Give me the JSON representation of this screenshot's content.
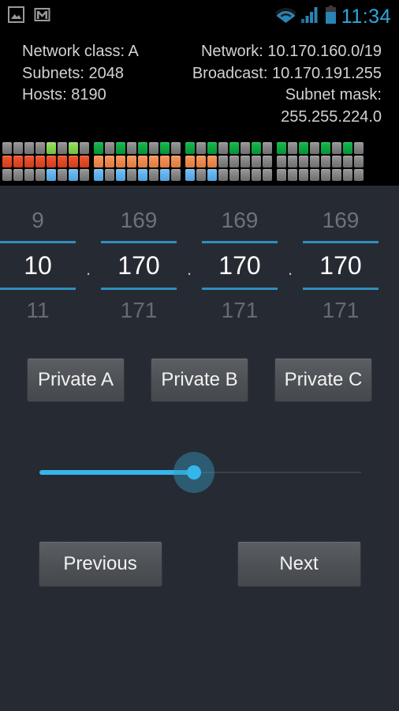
{
  "statusbar": {
    "icons_left": [
      "gallery-icon",
      "gmail-icon"
    ],
    "icons_right": [
      "wifi-icon",
      "cell-signal-icon",
      "battery-icon"
    ],
    "clock": "11:34",
    "clock_color": "#2aa9dd"
  },
  "info": {
    "left": [
      "Network class: A",
      "Subnets: 2048",
      "Hosts: 8190"
    ],
    "right": [
      "Network: 10.170.160.0/19",
      "Broadcast: 10.170.191.255",
      "Subnet mask: 255.255.224.0"
    ]
  },
  "bits": {
    "legend": {
      "off": "#848484",
      "light_green": "#86d352",
      "green": "#0ea842",
      "red": "#e34a26",
      "orange": "#ec8a4e",
      "blue": "#62b2ec"
    },
    "octets": [
      {
        "rows": [
          [
            "off",
            "off",
            "off",
            "off",
            "lgreen",
            "off",
            "lgreen",
            "off"
          ],
          [
            "red",
            "red",
            "red",
            "red",
            "red",
            "red",
            "red",
            "red"
          ],
          [
            "off",
            "off",
            "off",
            "off",
            "blue",
            "off",
            "blue",
            "off"
          ]
        ]
      },
      {
        "rows": [
          [
            "green",
            "off",
            "green",
            "off",
            "green",
            "off",
            "green",
            "off"
          ],
          [
            "orange",
            "orange",
            "orange",
            "orange",
            "orange",
            "orange",
            "orange",
            "orange"
          ],
          [
            "blue",
            "off",
            "blue",
            "off",
            "blue",
            "off",
            "blue",
            "off"
          ]
        ]
      },
      {
        "rows": [
          [
            "green",
            "off",
            "green",
            "off",
            "green",
            "off",
            "green",
            "off"
          ],
          [
            "orange",
            "orange",
            "orange",
            "off",
            "off",
            "off",
            "off",
            "off"
          ],
          [
            "blue",
            "off",
            "blue",
            "off",
            "off",
            "off",
            "off",
            "off"
          ]
        ]
      },
      {
        "rows": [
          [
            "green",
            "off",
            "green",
            "off",
            "green",
            "off",
            "green",
            "off"
          ],
          [
            "off",
            "off",
            "off",
            "off",
            "off",
            "off",
            "off",
            "off"
          ],
          [
            "off",
            "off",
            "off",
            "off",
            "off",
            "off",
            "off",
            "off"
          ]
        ]
      }
    ]
  },
  "picker": {
    "above": [
      "9",
      "169",
      "169",
      "169"
    ],
    "current": [
      "10",
      "170",
      "170",
      "170"
    ],
    "below": [
      "11",
      "171",
      "171",
      "171"
    ],
    "separator": ".",
    "underline_color": "#2f8fbe"
  },
  "private_buttons": [
    {
      "label": "Private A"
    },
    {
      "label": "Private B"
    },
    {
      "label": "Private C"
    }
  ],
  "slider": {
    "fill_percent": 48,
    "accent": "#35b6ea"
  },
  "nav": {
    "previous": "Previous",
    "next": "Next"
  }
}
